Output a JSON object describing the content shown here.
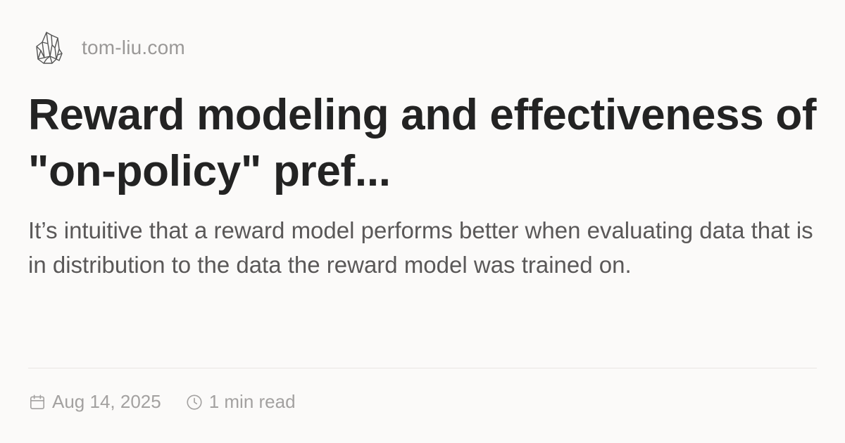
{
  "site": {
    "name": "tom-liu.com",
    "logo_icon": "crystal-logo-icon"
  },
  "post": {
    "title": "Reward modeling and effectiveness of \"on-policy\" pref...",
    "description": "It’s intuitive that a reward model performs better when evaluating data that is in distribution to the data the reward model was trained on.",
    "date": "Aug 14, 2025",
    "read_time": "1 min read"
  },
  "icons": {
    "date": "calendar-icon",
    "read_time": "clock-icon"
  },
  "colors": {
    "background": "#fbfaf9",
    "title": "#232323",
    "description": "#5a5858",
    "muted": "#a3a1a0",
    "divider": "#e9e6e3"
  }
}
